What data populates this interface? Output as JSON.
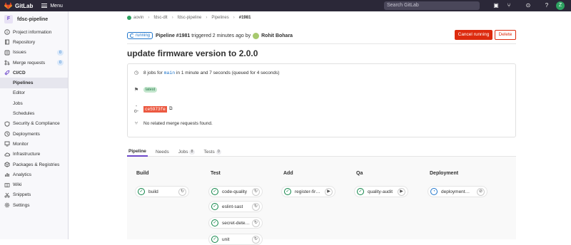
{
  "topbar": {
    "brand": "GitLab",
    "menu": "Menu",
    "search_placeholder": "Search GitLab",
    "avatar": "Z"
  },
  "sidebar": {
    "project_initial": "F",
    "project_name": "fdsc-pipeline",
    "items": [
      {
        "label": "Project information",
        "icon": "info-icon"
      },
      {
        "label": "Repository",
        "icon": "repository-icon"
      },
      {
        "label": "Issues",
        "icon": "issues-icon",
        "badge": "0"
      },
      {
        "label": "Merge requests",
        "icon": "merge-request-icon",
        "badge": "0"
      },
      {
        "label": "CI/CD",
        "icon": "rocket-icon",
        "active": true
      }
    ],
    "sub_items": [
      "Pipelines",
      "Editor",
      "Jobs",
      "Schedules"
    ],
    "items2": [
      {
        "label": "Security & Compliance",
        "icon": "shield-icon"
      },
      {
        "label": "Deployments",
        "icon": "deployments-icon"
      },
      {
        "label": "Monitor",
        "icon": "monitor-icon"
      },
      {
        "label": "Infrastructure",
        "icon": "cloud-icon"
      },
      {
        "label": "Packages & Registries",
        "icon": "package-icon"
      },
      {
        "label": "Analytics",
        "icon": "chart-icon"
      },
      {
        "label": "Wiki",
        "icon": "book-icon"
      },
      {
        "label": "Snippets",
        "icon": "snippet-icon"
      },
      {
        "label": "Settings",
        "icon": "gear-icon"
      }
    ]
  },
  "breadcrumb": [
    "aovin",
    "fdsc-dlt",
    "fdsc-pipeline",
    "Pipelines",
    "#1981"
  ],
  "pipeline": {
    "status": "running",
    "text_prefix": "Pipeline #1981",
    "text_middle": "triggered 2 minutes ago by",
    "user": "Rohit Bohara",
    "cancel_label": "Cancel running",
    "delete_label": "Delete",
    "title": "update firmware version to 2.0.0",
    "jobs_text_a": "8 jobs for",
    "branch": "main",
    "jobs_text_b": "in 1 minute and 7 seconds (queued for 4 seconds)",
    "tag": "latest",
    "sha": "ce5973fe",
    "mr_text": "No related merge requests found."
  },
  "tabs": [
    {
      "label": "Pipeline",
      "active": true
    },
    {
      "label": "Needs"
    },
    {
      "label": "Jobs",
      "count": "8"
    },
    {
      "label": "Tests",
      "count": "0"
    }
  ],
  "stages": [
    {
      "name": "Build",
      "jobs": [
        {
          "name": "build",
          "status": "passed",
          "action": "retry"
        }
      ]
    },
    {
      "name": "Test",
      "jobs": [
        {
          "name": "code-quality",
          "status": "passed",
          "action": "retry"
        },
        {
          "name": "eslint-sast",
          "status": "passed",
          "action": "retry"
        },
        {
          "name": "secret-dete…",
          "status": "passed",
          "action": "retry"
        },
        {
          "name": "unit",
          "status": "passed",
          "action": "retry"
        }
      ]
    },
    {
      "name": "Add",
      "jobs": [
        {
          "name": "register-fir…",
          "status": "passed",
          "action": "play"
        }
      ]
    },
    {
      "name": "Qa",
      "jobs": [
        {
          "name": "quality-audit",
          "status": "passed",
          "action": "play"
        }
      ]
    },
    {
      "name": "Deployment",
      "jobs": [
        {
          "name": "deployment…",
          "status": "running",
          "action": "cancel"
        }
      ]
    }
  ]
}
